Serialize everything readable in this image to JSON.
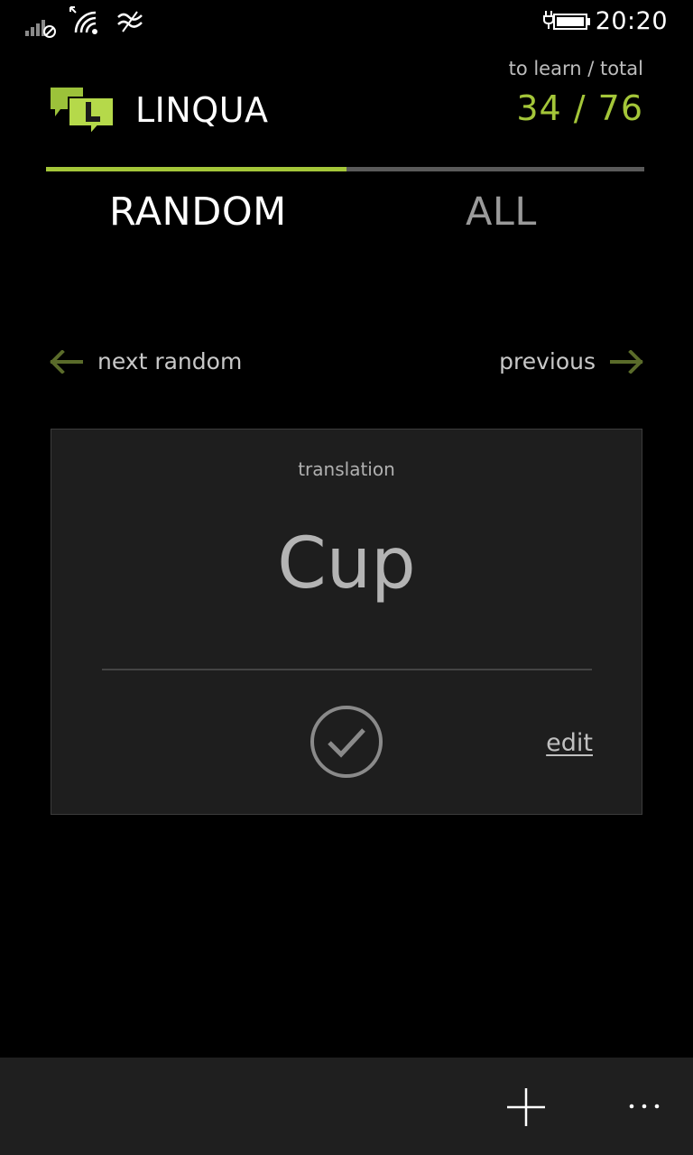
{
  "status_bar": {
    "time": "20:20",
    "icons": [
      "signal-icon",
      "wifi-icon",
      "network-sense-icon",
      "battery-charging-icon"
    ]
  },
  "header": {
    "app_title": "LINQUA",
    "logo_icon": "linqua-logo-icon",
    "counter_label": "to learn / total",
    "counter": "34 / 76",
    "accent_color": "#a4c639"
  },
  "tabs": {
    "items": [
      {
        "label": "RANDOM",
        "selected": true
      },
      {
        "label": "ALL",
        "selected": false
      }
    ]
  },
  "navigation": {
    "next_random_label": "next random",
    "previous_label": "previous",
    "left_arrow_icon": "arrow-left-icon",
    "right_arrow_icon": "arrow-right-icon"
  },
  "card": {
    "label": "translation",
    "word": "Cup",
    "check_icon": "check-circle-icon",
    "edit_label": "edit"
  },
  "app_bar": {
    "add_icon": "plus-icon",
    "more_icon": "ellipsis-icon"
  }
}
